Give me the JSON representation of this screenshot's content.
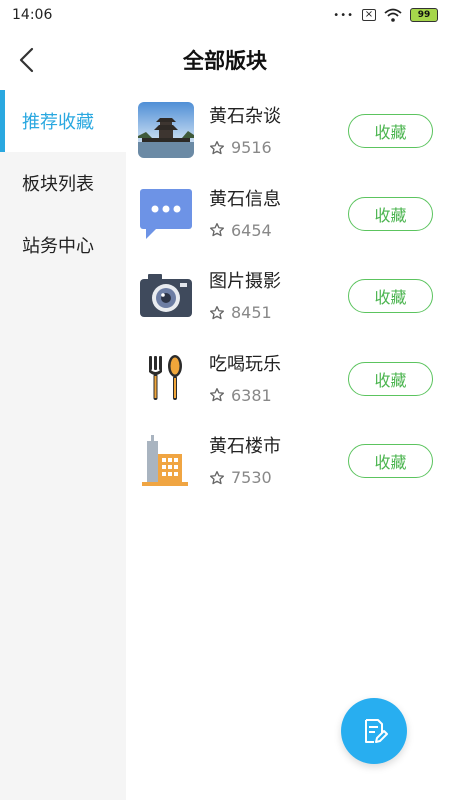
{
  "status_bar": {
    "time": "14:06",
    "battery": "99"
  },
  "header": {
    "title": "全部版块"
  },
  "sidebar": {
    "items": [
      {
        "label": "推荐收藏",
        "active": true
      },
      {
        "label": "板块列表",
        "active": false
      },
      {
        "label": "站务中心",
        "active": false
      }
    ]
  },
  "boards": [
    {
      "name": "黄石杂谈",
      "count": "9516",
      "button": "收藏",
      "icon": "pavilion-photo"
    },
    {
      "name": "黄石信息",
      "count": "6454",
      "button": "收藏",
      "icon": "message-bubble-icon"
    },
    {
      "name": "图片摄影",
      "count": "8451",
      "button": "收藏",
      "icon": "camera-icon"
    },
    {
      "name": "吃喝玩乐",
      "count": "6381",
      "button": "收藏",
      "icon": "utensils-icon"
    },
    {
      "name": "黄石楼市",
      "count": "7530",
      "button": "收藏",
      "icon": "buildings-icon"
    }
  ],
  "colors": {
    "accent": "#2aa8e0",
    "follow_green": "#4cb550",
    "fab": "#28aef0"
  }
}
